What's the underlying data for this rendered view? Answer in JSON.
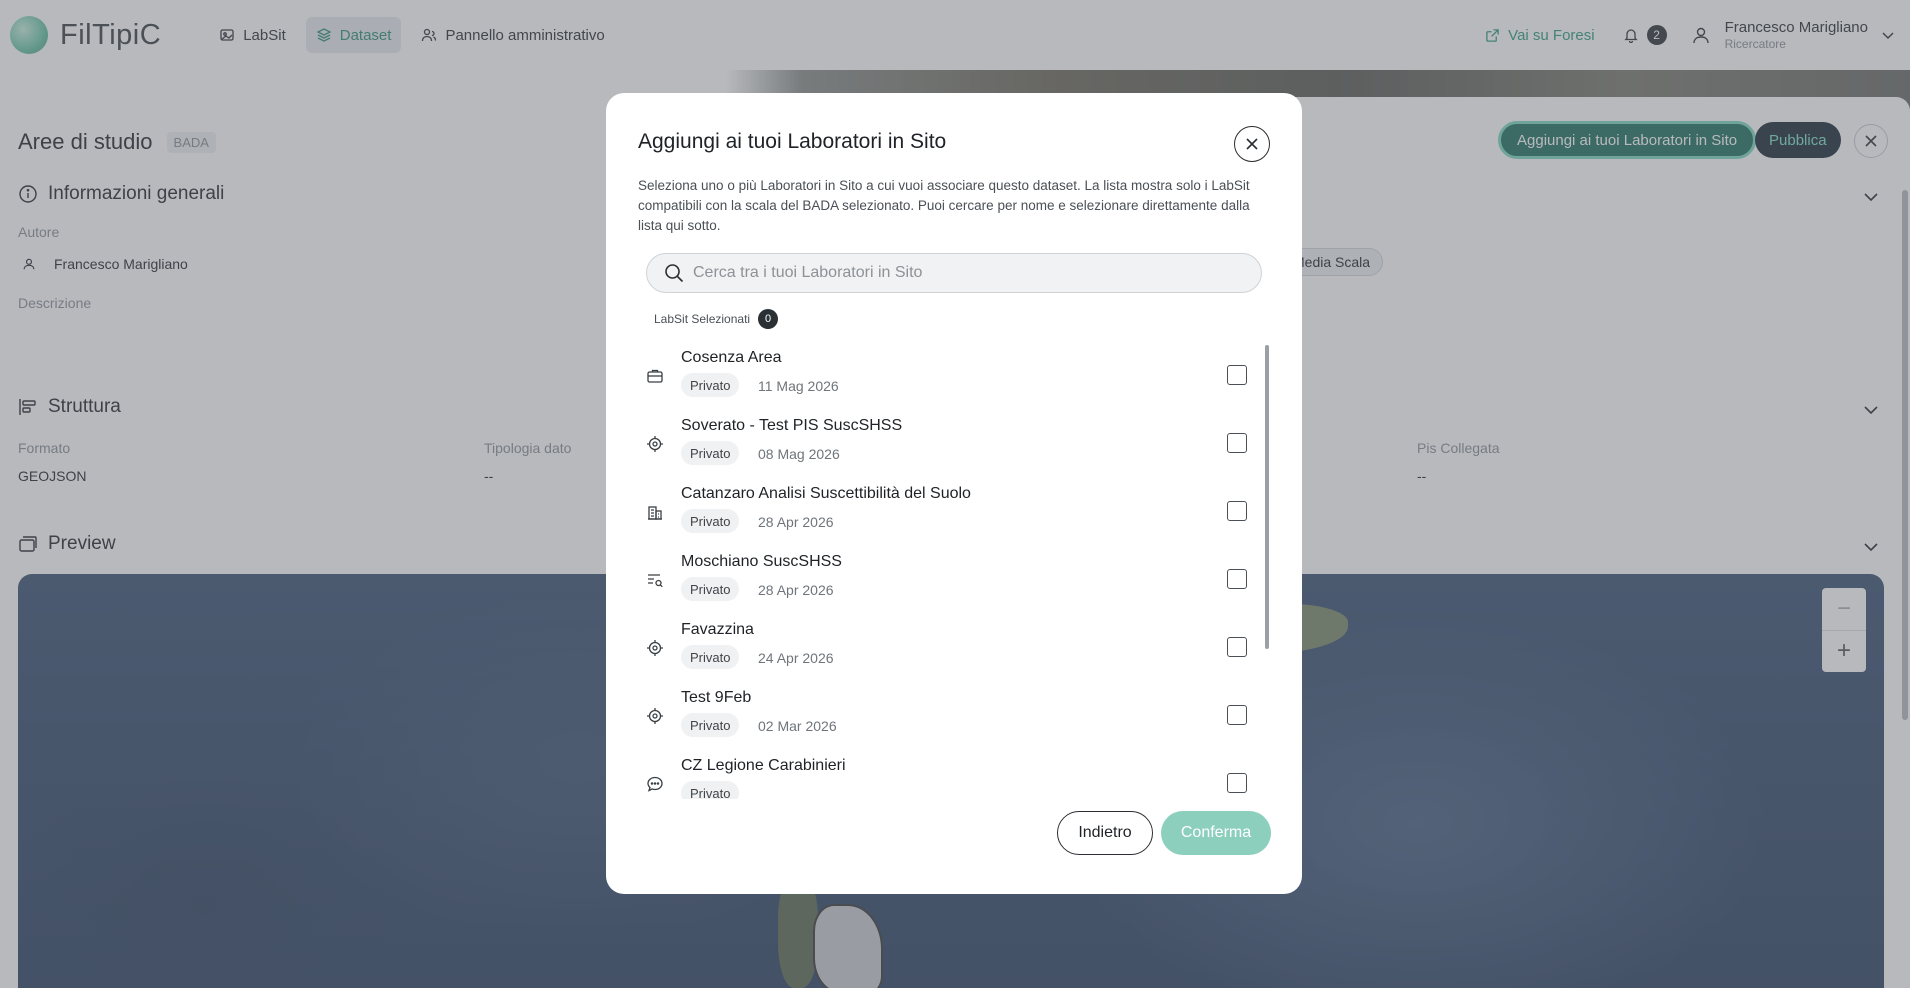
{
  "app": {
    "name": "FilTipiC"
  },
  "nav": {
    "items": [
      {
        "label": "LabSit",
        "icon": "image-icon"
      },
      {
        "label": "Dataset",
        "icon": "layers-icon",
        "active": true
      },
      {
        "label": "Pannello amministrativo",
        "icon": "users-icon"
      }
    ],
    "external_link": "Vai su Foresi",
    "notifications": "2",
    "user": {
      "name": "Francesco Marigliano",
      "role": "Ricercatore"
    }
  },
  "page": {
    "title": "Aree di studio",
    "tag": "BADA",
    "add_button": "Aggiungi ai tuoi Laboratori in Sito",
    "publish_button": "Pubblica",
    "sections": {
      "general": {
        "title": "Informazioni generali",
        "author_label": "Autore",
        "author_value": "Francesco Marigliano",
        "description_label": "Descrizione",
        "scale_chip": "Media Scala"
      },
      "structure": {
        "title": "Struttura",
        "format_label": "Formato",
        "format_value": "GEOJSON",
        "type_label": "Tipologia dato",
        "type_value": "--",
        "pis_label": "Pis Collegata",
        "pis_value": "--"
      },
      "preview": {
        "title": "Preview"
      }
    },
    "map": {
      "zoom_out": "−",
      "zoom_in": "+"
    }
  },
  "modal": {
    "title": "Aggiungi ai tuoi Laboratori in Sito",
    "description": "Seleziona uno o più Laboratori in Sito a cui vuoi associare questo dataset. La lista mostra solo i LabSit compatibili con la scala del BADA selezionato. Puoi cercare per nome e selezionare direttamente dalla lista qui sotto.",
    "search_placeholder": "Cerca tra i tuoi Laboratori in Sito",
    "selected_label": "LabSit Selezionati",
    "selected_count": "0",
    "items": [
      {
        "name": "Cosenza Area",
        "visibility": "Privato",
        "date": "11 Mag 2026",
        "icon": "briefcase-icon"
      },
      {
        "name": "Soverato - Test PIS SuscSHSS",
        "visibility": "Privato",
        "date": "08 Mag 2026",
        "icon": "target-icon"
      },
      {
        "name": "Catanzaro Analisi Suscettibilità del Suolo",
        "visibility": "Privato",
        "date": "28 Apr 2026",
        "icon": "building-icon"
      },
      {
        "name": "Moschiano SuscSHSS",
        "visibility": "Privato",
        "date": "28 Apr 2026",
        "icon": "list-search-icon"
      },
      {
        "name": "Favazzina",
        "visibility": "Privato",
        "date": "24 Apr 2026",
        "icon": "target-icon"
      },
      {
        "name": "Test 9Feb",
        "visibility": "Privato",
        "date": "02 Mar 2026",
        "icon": "target-icon"
      },
      {
        "name": "CZ Legione Carabinieri",
        "visibility": "Privato",
        "date": "",
        "icon": "chat-icon"
      }
    ],
    "back_button": "Indietro",
    "confirm_button": "Conferma"
  }
}
